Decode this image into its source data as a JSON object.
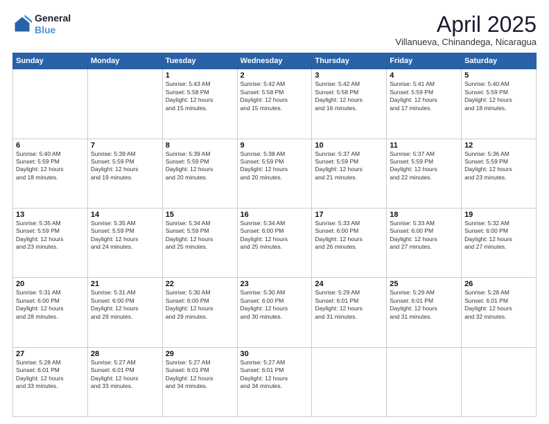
{
  "header": {
    "logo_line1": "General",
    "logo_line2": "Blue",
    "title": "April 2025",
    "subtitle": "Villanueva, Chinandega, Nicaragua"
  },
  "calendar": {
    "days_of_week": [
      "Sunday",
      "Monday",
      "Tuesday",
      "Wednesday",
      "Thursday",
      "Friday",
      "Saturday"
    ],
    "weeks": [
      [
        {
          "day": "",
          "info": ""
        },
        {
          "day": "",
          "info": ""
        },
        {
          "day": "1",
          "info": "Sunrise: 5:43 AM\nSunset: 5:58 PM\nDaylight: 12 hours\nand 15 minutes."
        },
        {
          "day": "2",
          "info": "Sunrise: 5:42 AM\nSunset: 5:58 PM\nDaylight: 12 hours\nand 15 minutes."
        },
        {
          "day": "3",
          "info": "Sunrise: 5:42 AM\nSunset: 5:58 PM\nDaylight: 12 hours\nand 16 minutes."
        },
        {
          "day": "4",
          "info": "Sunrise: 5:41 AM\nSunset: 5:59 PM\nDaylight: 12 hours\nand 17 minutes."
        },
        {
          "day": "5",
          "info": "Sunrise: 5:40 AM\nSunset: 5:59 PM\nDaylight: 12 hours\nand 18 minutes."
        }
      ],
      [
        {
          "day": "6",
          "info": "Sunrise: 5:40 AM\nSunset: 5:59 PM\nDaylight: 12 hours\nand 18 minutes."
        },
        {
          "day": "7",
          "info": "Sunrise: 5:39 AM\nSunset: 5:59 PM\nDaylight: 12 hours\nand 19 minutes."
        },
        {
          "day": "8",
          "info": "Sunrise: 5:39 AM\nSunset: 5:59 PM\nDaylight: 12 hours\nand 20 minutes."
        },
        {
          "day": "9",
          "info": "Sunrise: 5:38 AM\nSunset: 5:59 PM\nDaylight: 12 hours\nand 20 minutes."
        },
        {
          "day": "10",
          "info": "Sunrise: 5:37 AM\nSunset: 5:59 PM\nDaylight: 12 hours\nand 21 minutes."
        },
        {
          "day": "11",
          "info": "Sunrise: 5:37 AM\nSunset: 5:59 PM\nDaylight: 12 hours\nand 22 minutes."
        },
        {
          "day": "12",
          "info": "Sunrise: 5:36 AM\nSunset: 5:59 PM\nDaylight: 12 hours\nand 23 minutes."
        }
      ],
      [
        {
          "day": "13",
          "info": "Sunrise: 5:35 AM\nSunset: 5:59 PM\nDaylight: 12 hours\nand 23 minutes."
        },
        {
          "day": "14",
          "info": "Sunrise: 5:35 AM\nSunset: 5:59 PM\nDaylight: 12 hours\nand 24 minutes."
        },
        {
          "day": "15",
          "info": "Sunrise: 5:34 AM\nSunset: 5:59 PM\nDaylight: 12 hours\nand 25 minutes."
        },
        {
          "day": "16",
          "info": "Sunrise: 5:34 AM\nSunset: 6:00 PM\nDaylight: 12 hours\nand 25 minutes."
        },
        {
          "day": "17",
          "info": "Sunrise: 5:33 AM\nSunset: 6:00 PM\nDaylight: 12 hours\nand 26 minutes."
        },
        {
          "day": "18",
          "info": "Sunrise: 5:33 AM\nSunset: 6:00 PM\nDaylight: 12 hours\nand 27 minutes."
        },
        {
          "day": "19",
          "info": "Sunrise: 5:32 AM\nSunset: 6:00 PM\nDaylight: 12 hours\nand 27 minutes."
        }
      ],
      [
        {
          "day": "20",
          "info": "Sunrise: 5:31 AM\nSunset: 6:00 PM\nDaylight: 12 hours\nand 28 minutes."
        },
        {
          "day": "21",
          "info": "Sunrise: 5:31 AM\nSunset: 6:00 PM\nDaylight: 12 hours\nand 29 minutes."
        },
        {
          "day": "22",
          "info": "Sunrise: 5:30 AM\nSunset: 6:00 PM\nDaylight: 12 hours\nand 29 minutes."
        },
        {
          "day": "23",
          "info": "Sunrise: 5:30 AM\nSunset: 6:00 PM\nDaylight: 12 hours\nand 30 minutes."
        },
        {
          "day": "24",
          "info": "Sunrise: 5:29 AM\nSunset: 6:01 PM\nDaylight: 12 hours\nand 31 minutes."
        },
        {
          "day": "25",
          "info": "Sunrise: 5:29 AM\nSunset: 6:01 PM\nDaylight: 12 hours\nand 31 minutes."
        },
        {
          "day": "26",
          "info": "Sunrise: 5:28 AM\nSunset: 6:01 PM\nDaylight: 12 hours\nand 32 minutes."
        }
      ],
      [
        {
          "day": "27",
          "info": "Sunrise: 5:28 AM\nSunset: 6:01 PM\nDaylight: 12 hours\nand 33 minutes."
        },
        {
          "day": "28",
          "info": "Sunrise: 5:27 AM\nSunset: 6:01 PM\nDaylight: 12 hours\nand 33 minutes."
        },
        {
          "day": "29",
          "info": "Sunrise: 5:27 AM\nSunset: 6:01 PM\nDaylight: 12 hours\nand 34 minutes."
        },
        {
          "day": "30",
          "info": "Sunrise: 5:27 AM\nSunset: 6:01 PM\nDaylight: 12 hours\nand 34 minutes."
        },
        {
          "day": "",
          "info": ""
        },
        {
          "day": "",
          "info": ""
        },
        {
          "day": "",
          "info": ""
        }
      ]
    ]
  }
}
